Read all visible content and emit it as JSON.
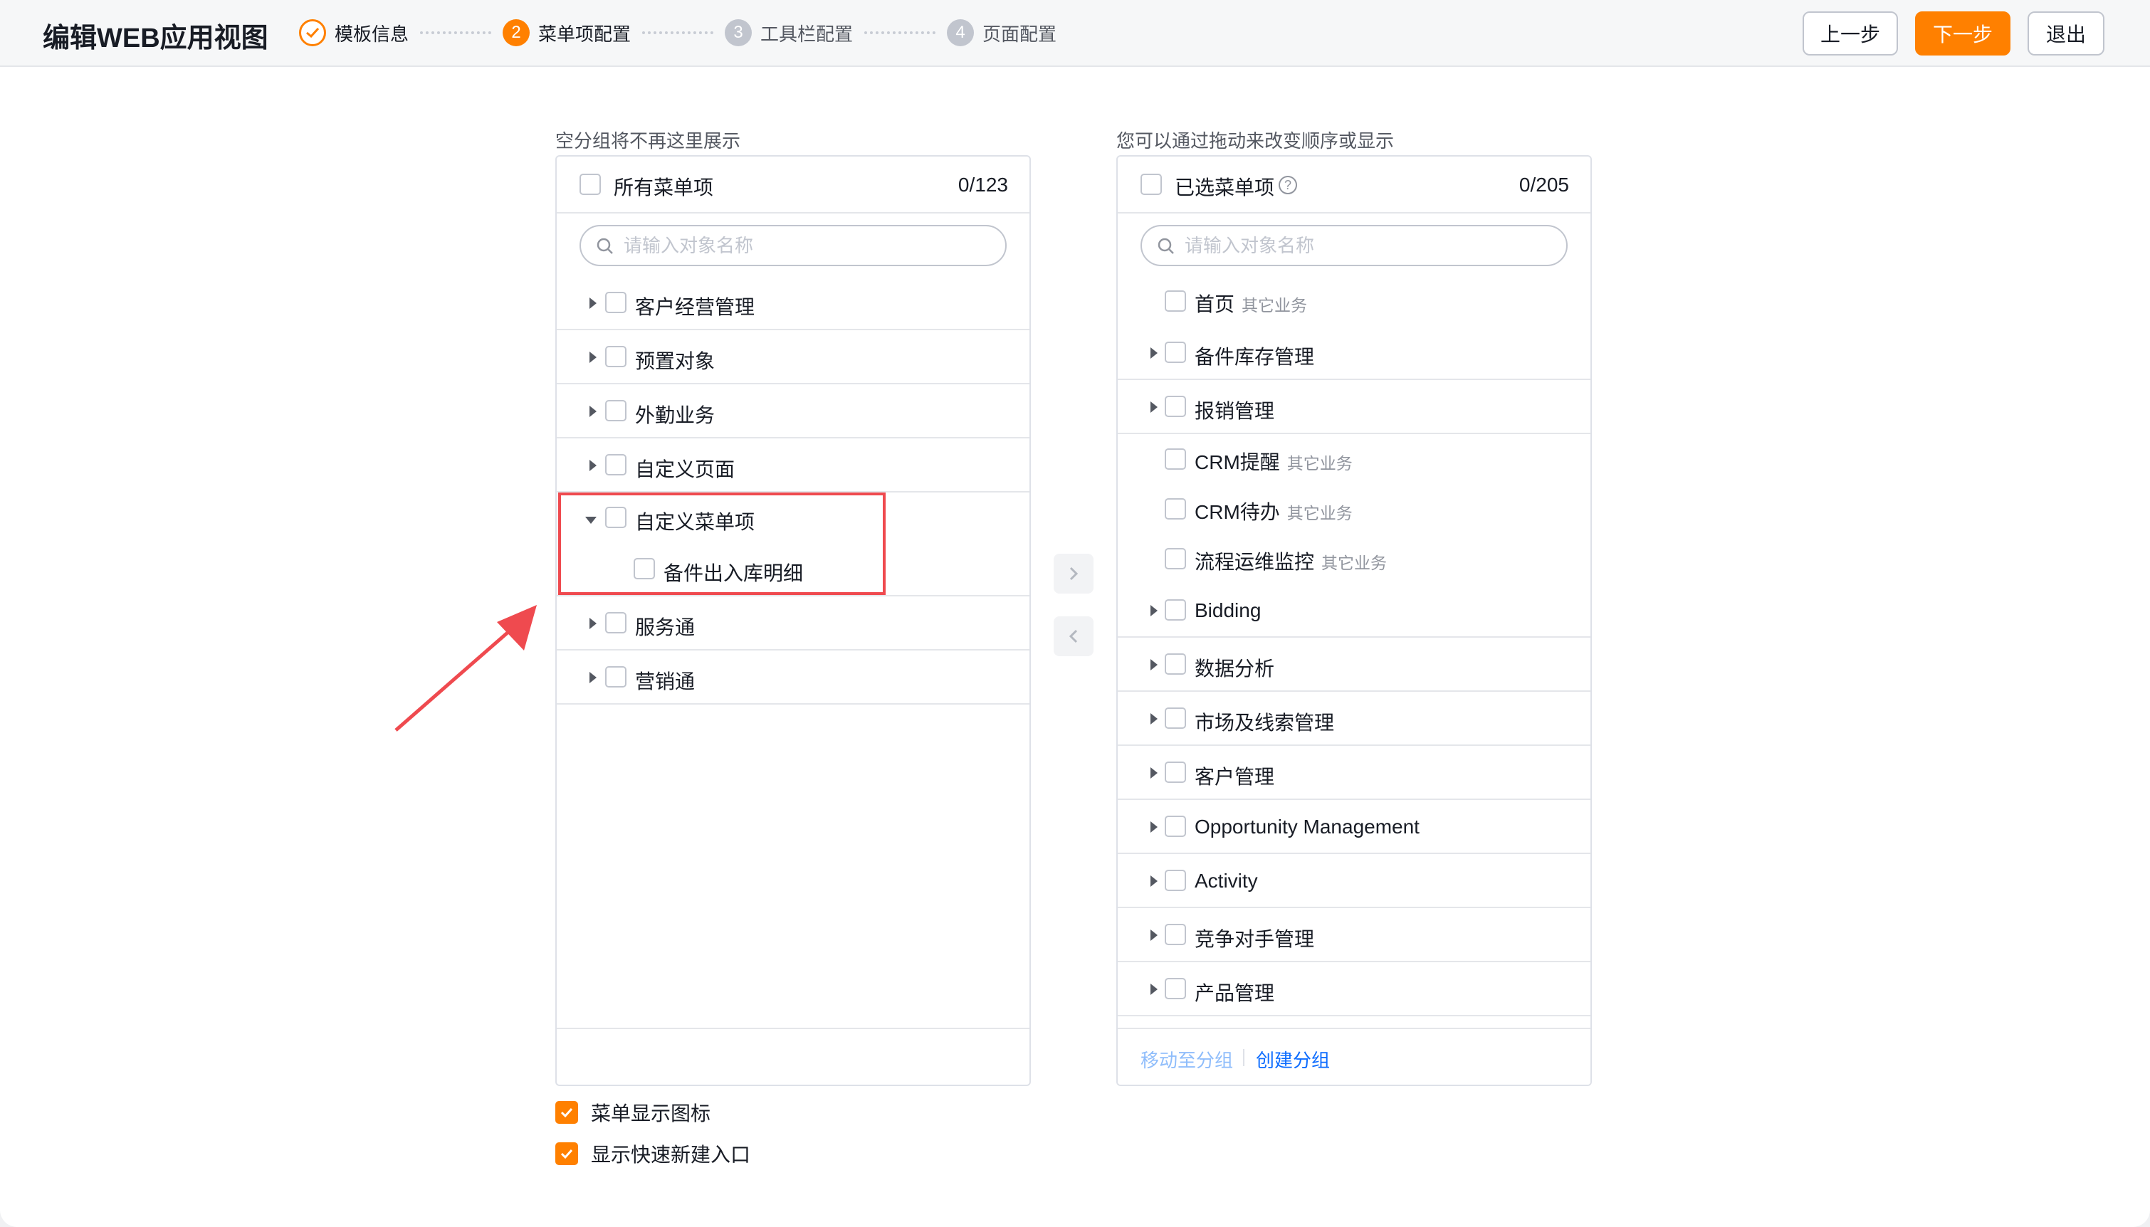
{
  "header": {
    "title": "编辑WEB应用视图",
    "steps": [
      {
        "label": "模板信息",
        "status": "done"
      },
      {
        "label": "菜单项配置",
        "number": "2",
        "status": "active"
      },
      {
        "label": "工具栏配置",
        "number": "3",
        "status": "todo"
      },
      {
        "label": "页面配置",
        "number": "4",
        "status": "todo"
      }
    ],
    "prev_label": "上一步",
    "next_label": "下一步",
    "exit_label": "退出"
  },
  "left_panel": {
    "caption": "空分组将不再这里展示",
    "header_label": "所有菜单项",
    "count": "0/123",
    "search_placeholder": "请输入对象名称",
    "groups": [
      {
        "label": "客户经营管理",
        "expanded": false
      },
      {
        "label": "预置对象",
        "expanded": false
      },
      {
        "label": "外勤业务",
        "expanded": false
      },
      {
        "label": "自定义页面",
        "expanded": false
      },
      {
        "label": "自定义菜单项",
        "expanded": true,
        "children": [
          "备件出入库明细"
        ]
      },
      {
        "label": "服务通",
        "expanded": false
      },
      {
        "label": "营销通",
        "expanded": false
      }
    ]
  },
  "right_panel": {
    "caption": "您可以通过拖动来改变顺序或显示",
    "header_label": "已选菜单项",
    "count": "0/205",
    "search_placeholder": "请输入对象名称",
    "items": [
      {
        "label": "首页",
        "tag": "其它业务",
        "group": false
      },
      {
        "label": "备件库存管理",
        "group": true
      },
      {
        "label": "报销管理",
        "group": true
      },
      {
        "label": "CRM提醒",
        "tag": "其它业务",
        "group": false
      },
      {
        "label": "CRM待办",
        "tag": "其它业务",
        "group": false
      },
      {
        "label": "流程运维监控",
        "tag": "其它业务",
        "group": false
      },
      {
        "label": "Bidding",
        "group": true
      },
      {
        "label": "数据分析",
        "group": true
      },
      {
        "label": "市场及线索管理",
        "group": true
      },
      {
        "label": "客户管理",
        "group": true
      },
      {
        "label": "Opportunity Management",
        "group": true
      },
      {
        "label": "Activity",
        "group": true
      },
      {
        "label": "竞争对手管理",
        "group": true
      },
      {
        "label": "产品管理",
        "group": true
      }
    ],
    "move_to_group_label": "移动至分组",
    "create_group_label": "创建分组"
  },
  "options": {
    "show_icon_label": "菜单显示图标",
    "show_icon_checked": true,
    "quick_create_label": "显示快速新建入口",
    "quick_create_checked": true
  },
  "colors": {
    "accent": "#ff8000",
    "link": "#0c6cff",
    "link_disabled": "#8fbdfb",
    "annotation": "#ef4a4f"
  }
}
